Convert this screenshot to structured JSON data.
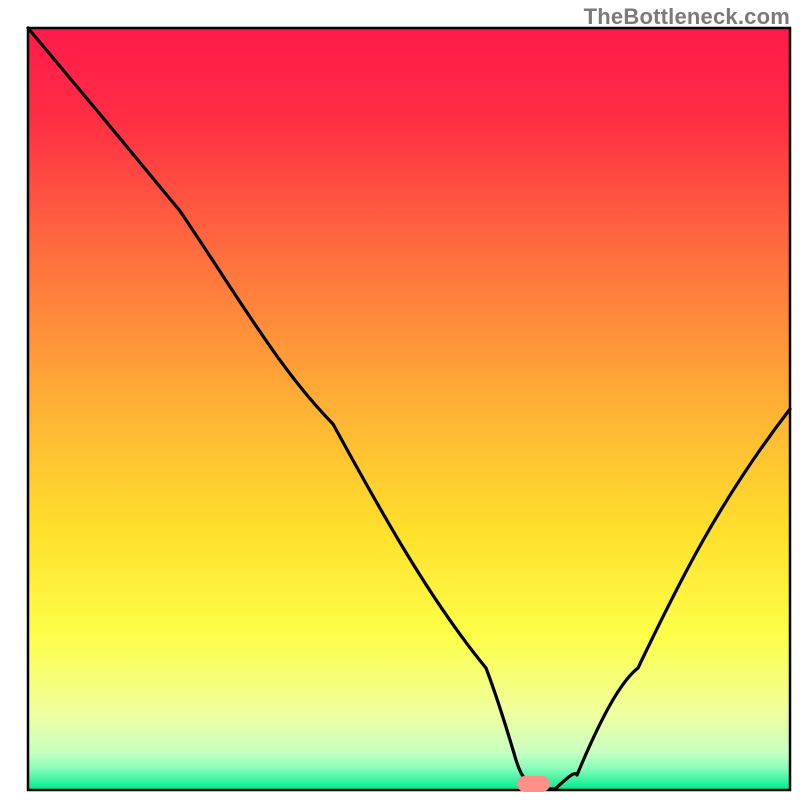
{
  "watermark": "TheBottleneck.com",
  "chart_data": {
    "type": "line",
    "title": "",
    "xlabel": "",
    "ylabel": "",
    "xlim": [
      0,
      100
    ],
    "ylim": [
      0,
      100
    ],
    "grid": false,
    "legend": false,
    "gradient_bands": [
      {
        "name": "red",
        "color_top": "#ff1a4b",
        "color_bottom": "#ff6f3f",
        "y_top": 100,
        "y_bottom": 60
      },
      {
        "name": "orange",
        "color_top": "#ff6f3f",
        "color_bottom": "#ffd92e",
        "y_top": 60,
        "y_bottom": 30
      },
      {
        "name": "yellow",
        "color_top": "#ffd92e",
        "color_bottom": "#f7ff66",
        "y_top": 30,
        "y_bottom": 12
      },
      {
        "name": "pale-yellow",
        "color_top": "#f7ff66",
        "color_bottom": "#eaffb0",
        "y_top": 12,
        "y_bottom": 5
      },
      {
        "name": "green",
        "color_top": "#7fffb0",
        "color_bottom": "#00e98f",
        "y_top": 5,
        "y_bottom": 0
      }
    ],
    "series": [
      {
        "name": "bottleneck-curve",
        "color": "#000000",
        "x": [
          0,
          10,
          20,
          30,
          40,
          50,
          60,
          64,
          67,
          72,
          80,
          90,
          100
        ],
        "y": [
          100,
          88,
          76,
          63,
          48,
          33,
          16,
          4,
          0,
          2,
          16,
          33,
          50
        ]
      }
    ],
    "marker": {
      "name": "optimal-point",
      "x": 66,
      "y": 0.8,
      "width": 3.6,
      "height": 2.0,
      "color": "#ff8f88"
    }
  }
}
